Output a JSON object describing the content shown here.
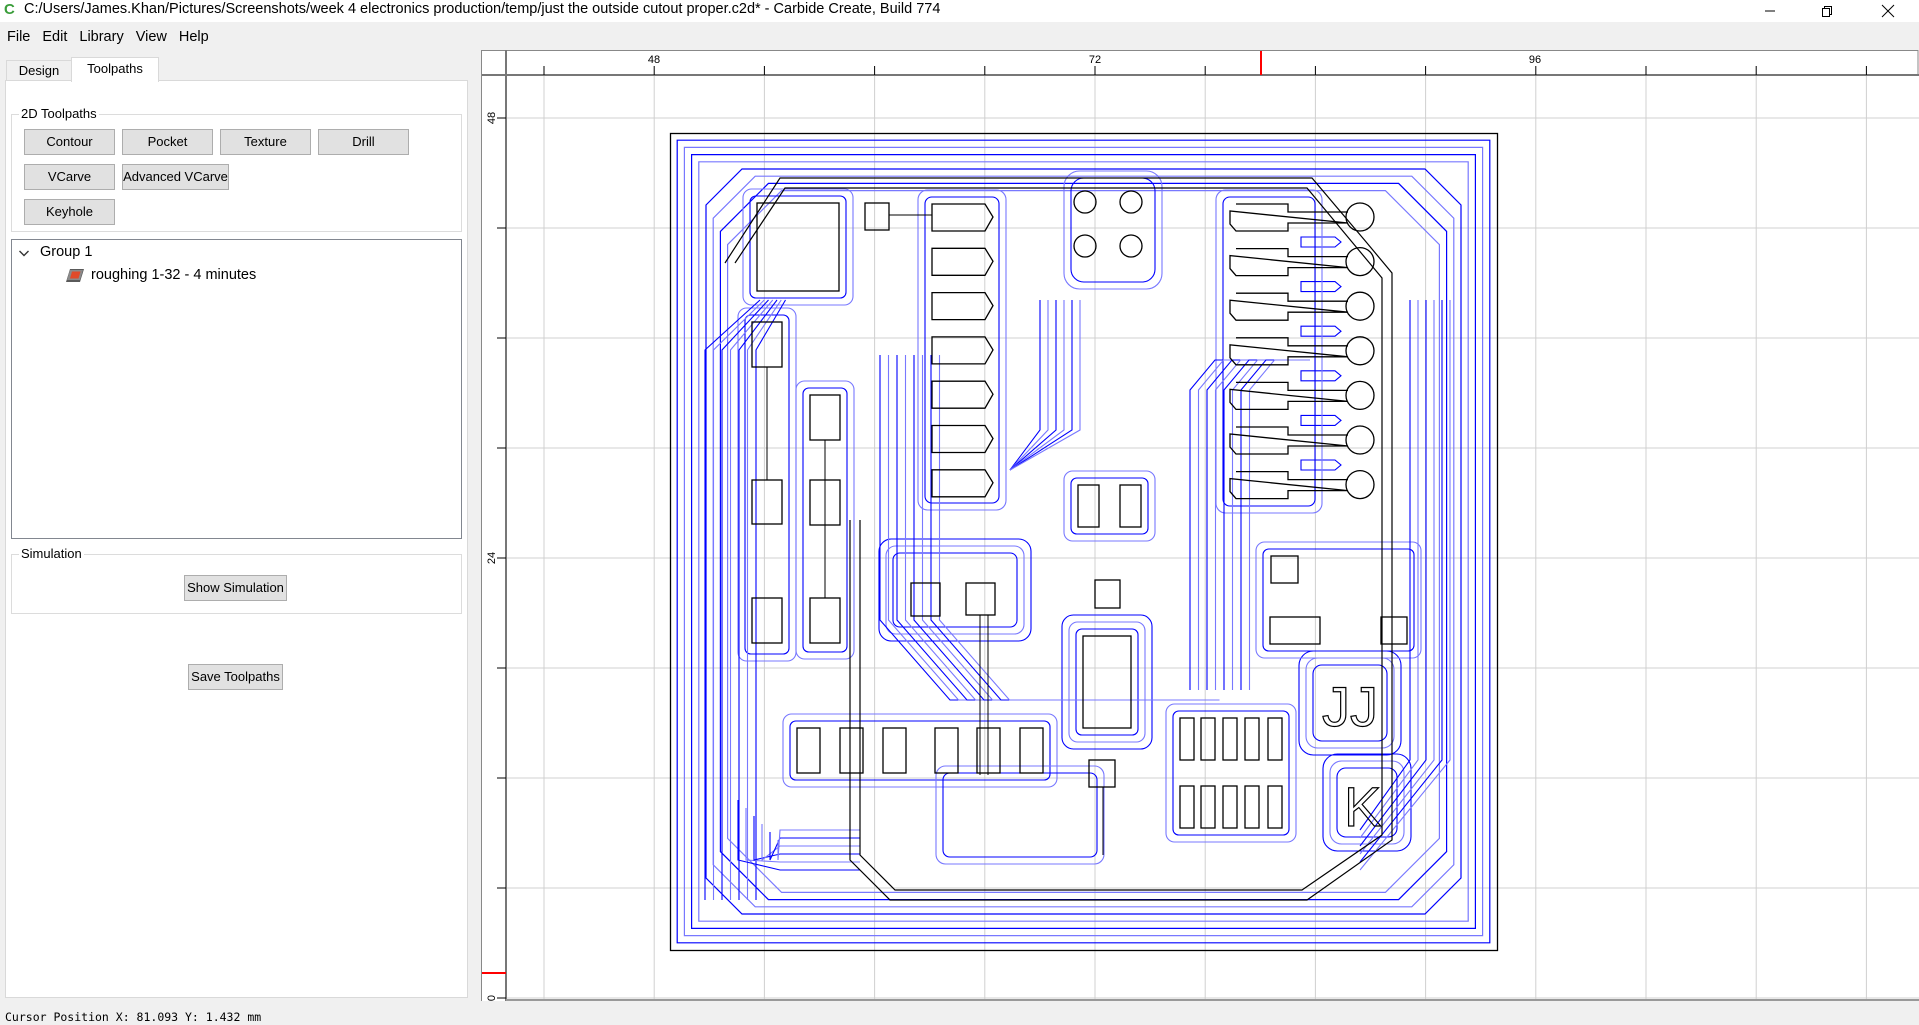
{
  "window": {
    "title": "C:/Users/James.Khan/Pictures/Screenshots/week 4 electronics production/temp/just the outside cutout proper.c2d* - Carbide Create, Build 774",
    "app_icon": "carbide-create-icon",
    "controls": {
      "minimize": "—",
      "restore": "❐",
      "close": "✕"
    }
  },
  "menu": [
    "File",
    "Edit",
    "Library",
    "View",
    "Help"
  ],
  "tabs": [
    {
      "label": "Design",
      "active": false
    },
    {
      "label": "Toolpaths",
      "active": true
    }
  ],
  "toolpaths_2d": {
    "title": "2D Toolpaths",
    "buttons": [
      "Contour",
      "Pocket",
      "Texture",
      "Drill",
      "VCarve",
      "Advanced VCarve",
      "Keyhole"
    ]
  },
  "tree": {
    "groups": [
      {
        "label": "Group 1",
        "expanded": true,
        "items": [
          {
            "label": "roughing 1-32 - 4 minutes",
            "icon": "toolpath-pocket-icon"
          }
        ]
      }
    ]
  },
  "simulation": {
    "title": "Simulation",
    "show_button": "Show Simulation"
  },
  "save_button": "Save Toolpaths",
  "status": {
    "cursor_position": "Cursor Position X: 81.093 Y: 1.432 mm",
    "cursor_x_mm": 81.093,
    "cursor_y_mm": 1.432
  },
  "rulers": {
    "x_labels": [
      "48",
      "72",
      "96"
    ],
    "y_labels": [
      "48",
      "24",
      "0"
    ],
    "units": "mm"
  },
  "colors": {
    "toolpath": "#0000ff",
    "toolpath_light": "#7878ff",
    "geometry": "#000000",
    "cursor_marker": "#ff0000",
    "grid": "#d0d0d0"
  }
}
